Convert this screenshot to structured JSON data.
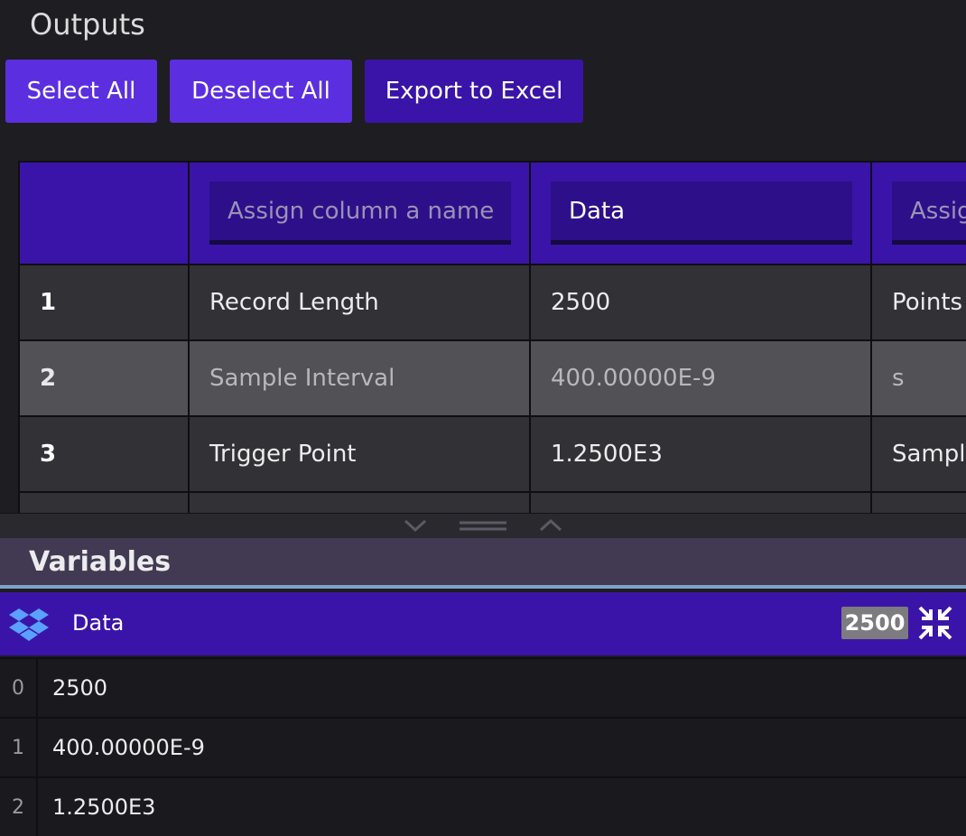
{
  "outputs": {
    "title": "Outputs",
    "buttons": {
      "select_all": "Select All",
      "deselect_all": "Deselect All",
      "export": "Export to Excel"
    },
    "table": {
      "header_inputs": [
        {
          "placeholder": "Assign column a name",
          "value": ""
        },
        {
          "placeholder": "Assign column a name",
          "value": "Data"
        },
        {
          "placeholder": "Assign column a name",
          "value": ""
        }
      ],
      "rows": [
        {
          "num": "1",
          "name": "Record Length",
          "data": "2500",
          "unit": "Points"
        },
        {
          "num": "2",
          "name": "Sample Interval",
          "data": "400.00000E-9",
          "unit": "s"
        },
        {
          "num": "3",
          "name": "Trigger Point",
          "data": "1.2500E3",
          "unit": "Samples"
        }
      ]
    }
  },
  "variables": {
    "title": "Variables",
    "data_bar": {
      "label": "Data",
      "count_badge": "2500",
      "icon": "dropbox-icon",
      "action_icon": "compress-icon"
    },
    "rows": [
      {
        "index": "0",
        "value": "2500"
      },
      {
        "index": "1",
        "value": "400.00000E-9"
      },
      {
        "index": "2",
        "value": "1.2500E3"
      }
    ]
  },
  "colors": {
    "accent": "#5b2fe0",
    "header": "#3a14a8",
    "background": "#1e1d21"
  }
}
